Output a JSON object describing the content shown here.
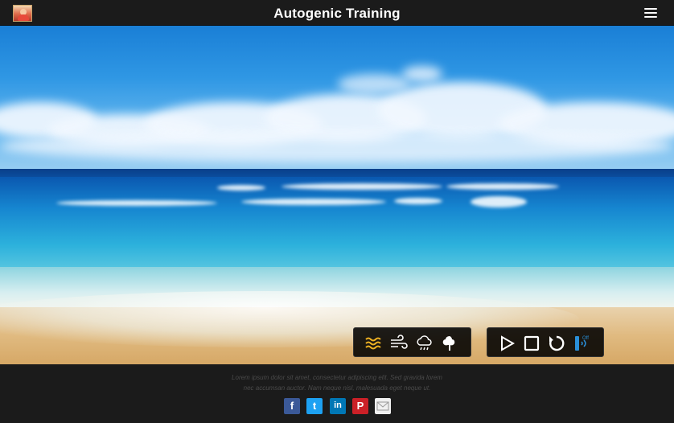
{
  "header": {
    "title": "Autogenic Training",
    "logo_icon": "meditation-logo-icon",
    "menu_icon": "hamburger-menu-icon"
  },
  "sound_controls": [
    {
      "name": "sound-waves-icon",
      "label": "waves"
    },
    {
      "name": "sound-wind-icon",
      "label": "wind"
    },
    {
      "name": "sound-rain-icon",
      "label": "rain"
    },
    {
      "name": "sound-forest-icon",
      "label": "forest"
    }
  ],
  "player_controls": [
    {
      "name": "play-icon"
    },
    {
      "name": "stop-icon"
    },
    {
      "name": "replay-icon"
    },
    {
      "name": "speaker-toggle-icon",
      "badge": "Off"
    }
  ],
  "footer": {
    "text_line1": "Lorem ipsum dolor sit amet, consectetur adipiscing elit. Sed gravida lorem",
    "text_line2": "nec accumsan auctor. Nam neque nisl, malesuada eget neque ut.",
    "social": [
      {
        "name": "facebook-icon",
        "glyph": "f",
        "color": "#3b5998"
      },
      {
        "name": "twitter-icon",
        "glyph": "t",
        "color": "#1da1f2"
      },
      {
        "name": "linkedin-icon",
        "glyph": "in",
        "color": "#0077b5"
      },
      {
        "name": "pinterest-icon",
        "glyph": "P",
        "color": "#cb2027"
      },
      {
        "name": "email-icon",
        "glyph": "",
        "color": "#f0f0f0"
      }
    ]
  },
  "colors": {
    "bar_background": "#1b1b1b",
    "active_sound": "#f0b323",
    "player_accent": "#2a8fd8"
  }
}
